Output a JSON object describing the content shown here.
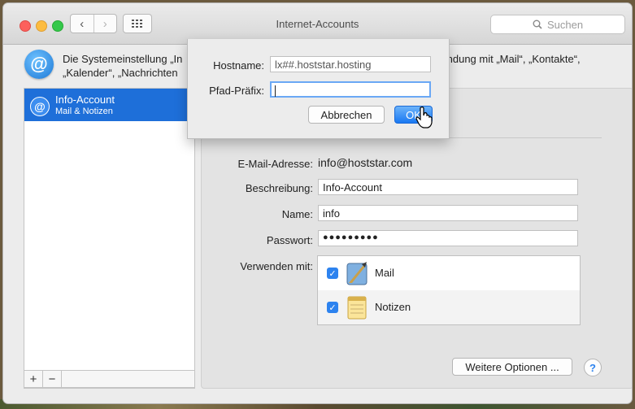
{
  "window": {
    "title": "Internet-Accounts",
    "search_placeholder": "Suchen"
  },
  "info": {
    "icon": "at-icon",
    "text_line1": "Die Systemeinstellung „Internet-Accounts“ ... Verbindung mit „Mail“, „Kontakte“,",
    "text_line1_left": "Die Systemeinstellung „In",
    "text_line1_right": "endung mit „Mail“, „Kontakte“,",
    "text_line2_left": "„Kalender“, „Nachrichten"
  },
  "sidebar": {
    "items": [
      {
        "name": "Info-Account",
        "subtitle": "Mail & Notizen"
      }
    ],
    "add_label": "+",
    "remove_label": "−"
  },
  "details": {
    "email_label": "E-Mail-Adresse:",
    "email_value": "info@hoststar.com",
    "description_label": "Beschreibung:",
    "description_value": "Info-Account",
    "name_label": "Name:",
    "name_value": "info",
    "password_label": "Passwort:",
    "password_value": "●●●●●●●●●",
    "use_with_label": "Verwenden mit:",
    "apps": [
      {
        "label": "Mail",
        "checked": true,
        "icon": "mail-app-icon"
      },
      {
        "label": "Notizen",
        "checked": true,
        "icon": "notes-app-icon"
      }
    ],
    "more_options_label": "Weitere Optionen ...",
    "help_label": "?"
  },
  "sheet": {
    "hostname_label": "Hostname:",
    "hostname_value": "lx##.hoststar.hosting",
    "prefix_label": "Pfad-Präfix:",
    "prefix_value": "",
    "cancel_label": "Abbrechen",
    "ok_label": "OK"
  },
  "colors": {
    "accent": "#1e6fd9",
    "button_blue": "#1a78f2"
  }
}
